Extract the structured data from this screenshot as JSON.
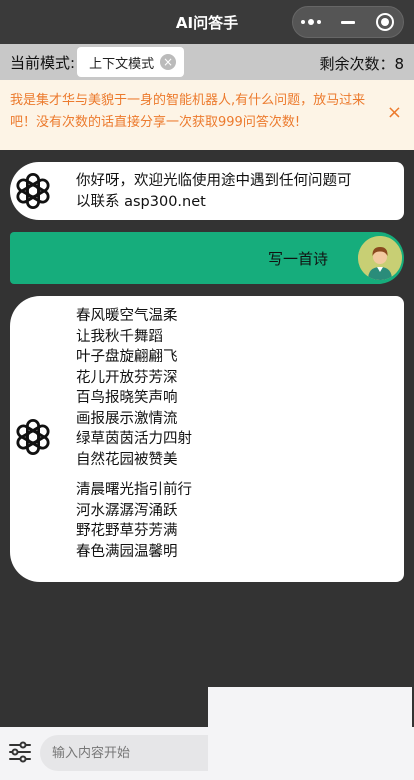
{
  "nav": {
    "title": "AI问答手"
  },
  "modebar": {
    "label": "当前模式:",
    "chip": "上下文模式",
    "chip_close": "×",
    "remaining": "剩余次数：8"
  },
  "notice": {
    "text": "我是集才华与美貌于一身的智能机器人,有什么问题，放马过来吧！没有次数的话直接分享一次获取999问答次数!",
    "close": "×"
  },
  "messages": {
    "ai_greeting": [
      "你好呀，欢迎光临使用途中遇到任何问题可",
      "以联系  asp300.net"
    ],
    "user_prompt": "写一首诗",
    "ai_poem": [
      "春风暖空气温柔",
      "让我秋千舞蹈",
      "叶子盘旋翩翩飞",
      "花儿开放芬芳深",
      "百鸟报晓笑声响",
      "画报展示激情流",
      "绿草茵茵活力四射",
      "自然花园被赞美",
      "",
      "清晨曙光指引前行",
      "河水潺潺泻涌跃",
      "野花野草芬芳满",
      "春色满园温馨明"
    ]
  },
  "input": {
    "placeholder": "输入内容开始"
  },
  "colors": {
    "background": "#333333",
    "accent": "#16ad7c",
    "notice_text": "#ec7a2d",
    "notice_bg": "#fdf4e6"
  },
  "icons": {
    "ai_avatar": "openai-logo-icon",
    "user_avatar": "user-avatar-icon",
    "settings": "sliders-icon"
  }
}
